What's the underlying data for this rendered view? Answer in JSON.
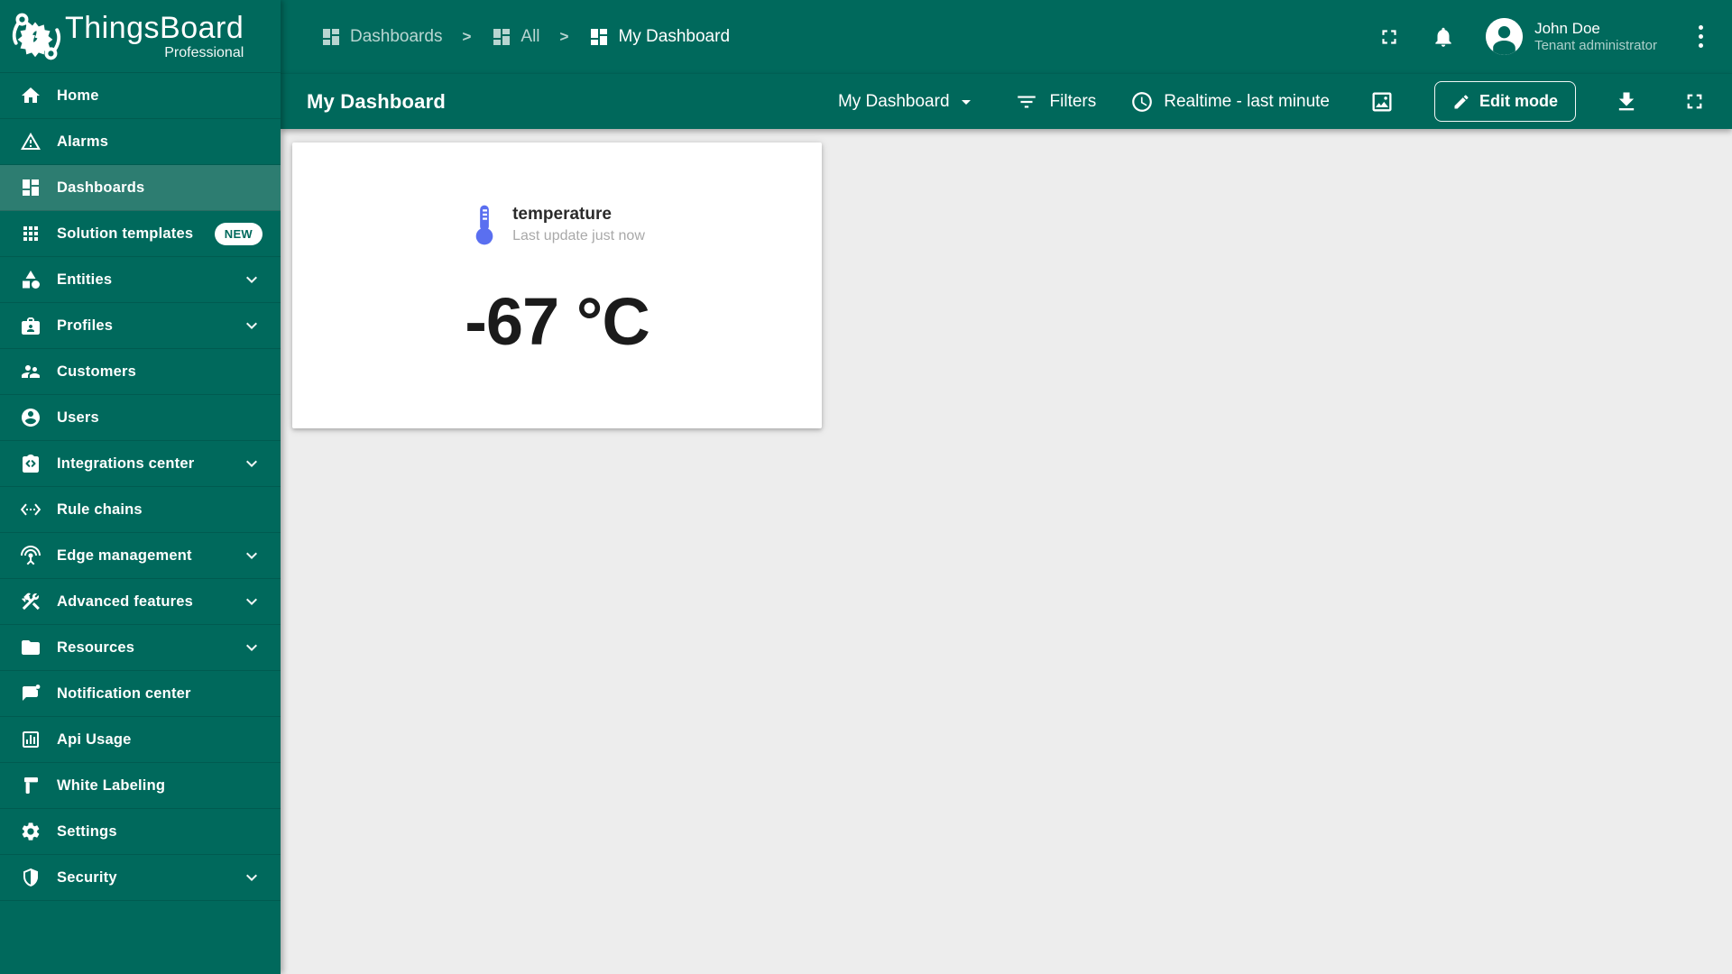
{
  "app": {
    "brand": "ThingsBoard",
    "brand_sub": "Professional"
  },
  "header": {
    "breadcrumbs": [
      {
        "label": "Dashboards"
      },
      {
        "label": "All"
      },
      {
        "label": "My Dashboard"
      }
    ],
    "separator": ">",
    "user": {
      "name": "John Doe",
      "role": "Tenant administrator"
    }
  },
  "toolbar": {
    "title": "My Dashboard",
    "dashboard_select": "My Dashboard",
    "filters_label": "Filters",
    "timewindow_label": "Realtime - last minute",
    "edit_label": "Edit mode"
  },
  "sidebar": {
    "items": [
      {
        "label": "Home",
        "icon": "home-icon"
      },
      {
        "label": "Alarms",
        "icon": "alarm-warning-icon"
      },
      {
        "label": "Dashboards",
        "icon": "dashboards-icon",
        "selected": true
      },
      {
        "label": "Solution templates",
        "icon": "apps-grid-icon",
        "badge": "NEW"
      },
      {
        "label": "Entities",
        "icon": "entities-shapes-icon",
        "expandable": true
      },
      {
        "label": "Profiles",
        "icon": "profiles-badge-icon",
        "expandable": true
      },
      {
        "label": "Customers",
        "icon": "customers-people-icon"
      },
      {
        "label": "Users",
        "icon": "user-circle-icon"
      },
      {
        "label": "Integrations center",
        "icon": "integrations-icon",
        "expandable": true
      },
      {
        "label": "Rule chains",
        "icon": "rule-chains-icon"
      },
      {
        "label": "Edge management",
        "icon": "antenna-icon",
        "expandable": true
      },
      {
        "label": "Advanced features",
        "icon": "tools-icon",
        "expandable": true
      },
      {
        "label": "Resources",
        "icon": "folder-icon",
        "expandable": true
      },
      {
        "label": "Notification center",
        "icon": "notification-chat-icon"
      },
      {
        "label": "Api Usage",
        "icon": "bar-chart-icon"
      },
      {
        "label": "White Labeling",
        "icon": "paint-roller-icon"
      },
      {
        "label": "Settings",
        "icon": "gear-icon"
      },
      {
        "label": "Security",
        "icon": "shield-icon",
        "expandable": true
      }
    ]
  },
  "widget": {
    "title": "temperature",
    "subtitle": "Last update just now",
    "value": "-67 °C"
  },
  "colors": {
    "chrome_teal": "#00695c",
    "sidebar_selected": "#2d7d71",
    "content_bg": "#ededed",
    "card_bg": "#ffffff",
    "widget_icon_blue": "#5a6ff0",
    "new_badge_bg": "#ffffff",
    "new_badge_text": "#00695c"
  }
}
